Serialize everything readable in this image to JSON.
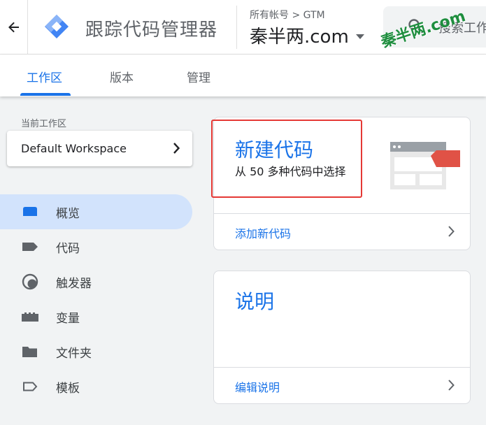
{
  "header": {
    "app_title": "跟踪代码管理器",
    "breadcrumb": "所有帐号 > GTM",
    "container_name": "秦半两.com",
    "search_placeholder": "搜索工作",
    "watermark": "秦半两.com"
  },
  "tabs": [
    {
      "label": "工作区",
      "active": true
    },
    {
      "label": "版本",
      "active": false
    },
    {
      "label": "管理",
      "active": false
    }
  ],
  "sidebar": {
    "workspace_caption": "当前工作区",
    "workspace_name": "Default Workspace",
    "items": [
      {
        "label": "概览",
        "icon": "overview-icon",
        "active": true
      },
      {
        "label": "代码",
        "icon": "tag-icon",
        "active": false
      },
      {
        "label": "触发器",
        "icon": "trigger-icon",
        "active": false
      },
      {
        "label": "变量",
        "icon": "variable-icon",
        "active": false
      },
      {
        "label": "文件夹",
        "icon": "folder-icon",
        "active": false
      },
      {
        "label": "模板",
        "icon": "template-icon",
        "active": false
      }
    ]
  },
  "cards": {
    "new_tag": {
      "title": "新建代码",
      "subtitle": "从 50 多种代码中选择",
      "link": "添加新代码"
    },
    "description": {
      "title": "说明",
      "link": "编辑说明"
    }
  },
  "colors": {
    "accent": "#1a73e8",
    "nav_active_bg": "#d2e3fc",
    "highlight": "#e53935",
    "watermark": "#1e8e3e"
  }
}
